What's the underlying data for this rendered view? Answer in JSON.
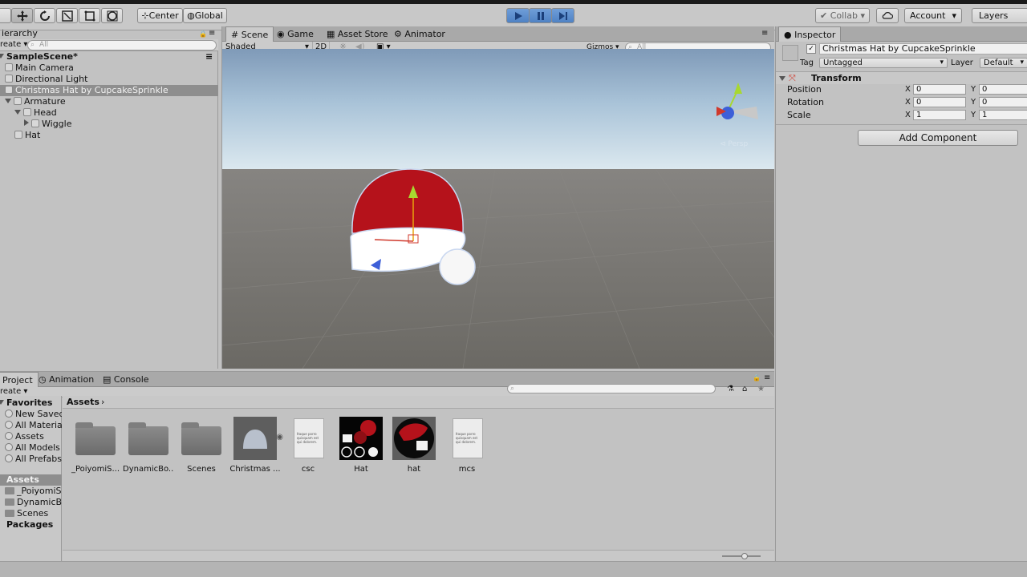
{
  "toolbar": {
    "pivot": "Center",
    "space": "Global",
    "collab": "Collab",
    "account": "Account",
    "layers": "Layers"
  },
  "hierarchy": {
    "tab": "Hierarchy",
    "tab_visible": "ierarchy",
    "create": "reate",
    "search_placeholder": "All",
    "scene": "SampleScene*",
    "items": [
      {
        "label": "Main Camera"
      },
      {
        "label": "Directional Light"
      },
      {
        "label": "Christmas Hat by CupcakeSprinkle"
      },
      {
        "label": "Armature"
      },
      {
        "label": "Head"
      },
      {
        "label": "Wiggle"
      },
      {
        "label": "Hat"
      }
    ]
  },
  "scene": {
    "tabs": [
      {
        "label": "Scene"
      },
      {
        "label": "Game"
      },
      {
        "label": "Asset Store"
      },
      {
        "label": "Animator"
      }
    ],
    "shading": "Shaded",
    "mode2d": "2D",
    "gizmos": "Gizmos",
    "search_placeholder": "All",
    "persp": "Persp",
    "colors": {
      "hat_red": "#b5121b",
      "trim": "#ffffff",
      "sky": "#a9c3d8",
      "ground": "#7a7873"
    }
  },
  "inspector": {
    "tab": "Inspector",
    "object_name": "Christmas Hat by CupcakeSprinkle",
    "tag_label": "Tag",
    "tag_value": "Untagged",
    "layer_label": "Layer",
    "layer_value": "Default",
    "component": "Transform",
    "rows": [
      {
        "label": "Position",
        "x": "0",
        "y": "0"
      },
      {
        "label": "Rotation",
        "x": "0",
        "y": "0"
      },
      {
        "label": "Scale",
        "x": "1",
        "y": "1"
      }
    ],
    "axis_x": "X",
    "axis_y": "Y",
    "add_component": "Add Component"
  },
  "project": {
    "tabs": [
      {
        "label": "Project"
      },
      {
        "label": "Animation"
      },
      {
        "label": "Console"
      }
    ],
    "create": "reate",
    "favorites_header": "Favorites",
    "favorites": [
      {
        "label": "New Saved"
      },
      {
        "label": "All Materials"
      },
      {
        "label": "Assets"
      },
      {
        "label": "All Models"
      },
      {
        "label": "All Prefabs"
      }
    ],
    "assets_header": "Assets",
    "asset_folders": [
      {
        "label": "_PoiyomiSh"
      },
      {
        "label": "DynamicBo"
      },
      {
        "label": "Scenes"
      }
    ],
    "packages": "Packages",
    "breadcrumb": "Assets",
    "assets": [
      {
        "label": "_PoiyomiS...",
        "kind": "folder"
      },
      {
        "label": "DynamicBo...",
        "kind": "folder"
      },
      {
        "label": "Scenes",
        "kind": "folder"
      },
      {
        "label": "Christmas ...",
        "kind": "model"
      },
      {
        "label": "csc",
        "kind": "text"
      },
      {
        "label": "Hat",
        "kind": "texture"
      },
      {
        "label": "hat",
        "kind": "material"
      },
      {
        "label": "mcs",
        "kind": "text"
      }
    ],
    "doc_text": "Itaque porro quisquam est qui dolorem."
  }
}
